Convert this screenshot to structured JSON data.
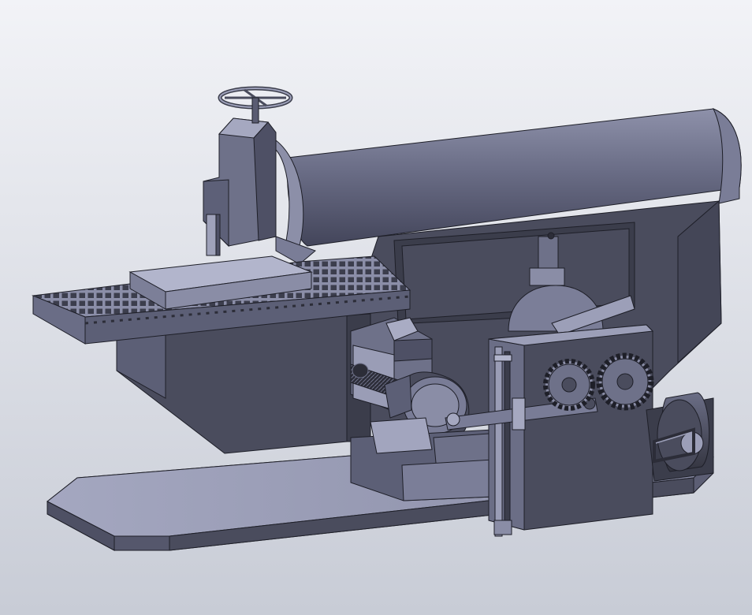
{
  "viewport": {
    "background_top": "#f2f3f7",
    "background_bottom": "#c8ccd6"
  },
  "model": {
    "subject": "shaper-machine-cad-model",
    "palette": {
      "light": "#9c9fb8",
      "mid": "#6e7189",
      "dark": "#4a4c5d",
      "darker": "#3b3d4b",
      "deep": "#2c2d38",
      "edge": "#1e1f28"
    },
    "components": {
      "handwheel-icon": "handwheel",
      "tool-head": "tool-head",
      "ram": "ram",
      "worktable": "worktable",
      "workpiece": "workpiece",
      "column-body": "column",
      "base-plate": "base",
      "gear-icon": "gear",
      "motor-icon": "motor",
      "belt-drive": "belt",
      "crank-disc": "crank",
      "lead-screw": "screw"
    }
  }
}
